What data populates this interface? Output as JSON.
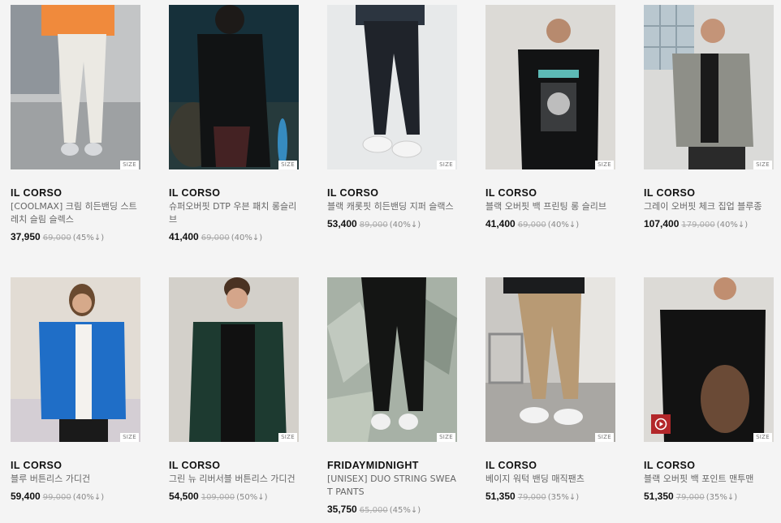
{
  "products": [
    {
      "brand": "IL CORSO",
      "name": "[COOLMAX] 크림 히든밴딩 스트레치 슬림 슬렉스",
      "price": "37,950",
      "original": "69,000",
      "discount": "(45%↓)",
      "size": "SIZE",
      "bg": "#b9bcbe"
    },
    {
      "brand": "IL CORSO",
      "name": "슈퍼오버핏 DTP 우븐 패치 롱슬리브",
      "price": "41,400",
      "original": "69,000",
      "discount": "(40%↓)",
      "size": "SIZE",
      "bg": "#1f3a44"
    },
    {
      "brand": "IL CORSO",
      "name": "블랙 캐롯핏 히든밴딩 지퍼 슬랙스",
      "price": "53,400",
      "original": "89,000",
      "discount": "(40%↓)",
      "size": "SIZE",
      "bg": "#e9ebec"
    },
    {
      "brand": "IL CORSO",
      "name": "블랙 오버핏 백 프린팅 롱 슬리브",
      "price": "41,400",
      "original": "69,000",
      "discount": "(40%↓)",
      "size": "SIZE",
      "bg": "#d8d6d2"
    },
    {
      "brand": "IL CORSO",
      "name": "그레이 오버핏 체크 집업 블루종",
      "price": "107,400",
      "original": "179,000",
      "discount": "(40%↓)",
      "size": "SIZE",
      "bg": "#d2d2d0"
    },
    {
      "brand": "IL CORSO",
      "name": "블루 버튼리스 가디건",
      "price": "59,400",
      "original": "99,000",
      "discount": "(40%↓)",
      "size": "SIZE",
      "bg": "#ddd7d0"
    },
    {
      "brand": "IL CORSO",
      "name": "그린 뉴 리버서블 버튼리스 가디건",
      "price": "54,500",
      "original": "109,000",
      "discount": "(50%↓)",
      "size": "SIZE",
      "bg": "#cfccc6"
    },
    {
      "brand": "FRIDAYMIDNIGHT",
      "name": "[UNISEX] DUO STRING SWEAT PANTS",
      "price": "35,750",
      "original": "65,000",
      "discount": "(45%↓)",
      "size": "SIZE",
      "bg": "#9aa59a"
    },
    {
      "brand": "IL CORSO",
      "name": "베이지 워턱 밴딩 매직팬츠",
      "price": "51,350",
      "original": "79,000",
      "discount": "(35%↓)",
      "size": "SIZE",
      "bg": "#c4c2be"
    },
    {
      "brand": "IL CORSO",
      "name": "블랙 오버핏 백 포인트 맨투맨",
      "price": "51,350",
      "original": "79,000",
      "discount": "(35%↓)",
      "size": "SIZE",
      "bg": "#d9d7d3"
    }
  ],
  "colors": {
    "play_badge": "#b3272a",
    "sale_price": "#111111",
    "original_price": "#aaaaaa"
  },
  "icons": {
    "video": "play-icon"
  }
}
